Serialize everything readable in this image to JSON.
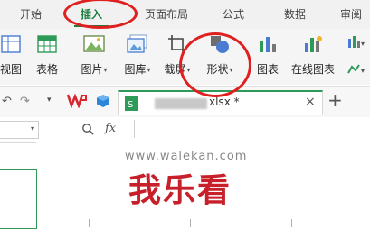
{
  "menu_tabs": [
    "开始",
    "插入",
    "页面布局",
    "公式",
    "数据",
    "审阅"
  ],
  "active_tab": "插入",
  "ribbon": {
    "pivot_view": "视图",
    "table": "表格",
    "picture": "图片",
    "gallery": "图库",
    "screenshot": "截屏",
    "shapes": "形状",
    "chart": "图表",
    "online_chart": "在线图表"
  },
  "doc_tab": {
    "file_ext": "xlsx *",
    "close": "×",
    "add": "+"
  },
  "formula_bar": {
    "fx": "fx"
  },
  "watermark": {
    "url": "www.walekan.com",
    "brand": "我乐看"
  },
  "colors": {
    "accent_green": "#1a7e3e",
    "annotation_red": "#e02020",
    "watermark_red": "#c8202a"
  }
}
